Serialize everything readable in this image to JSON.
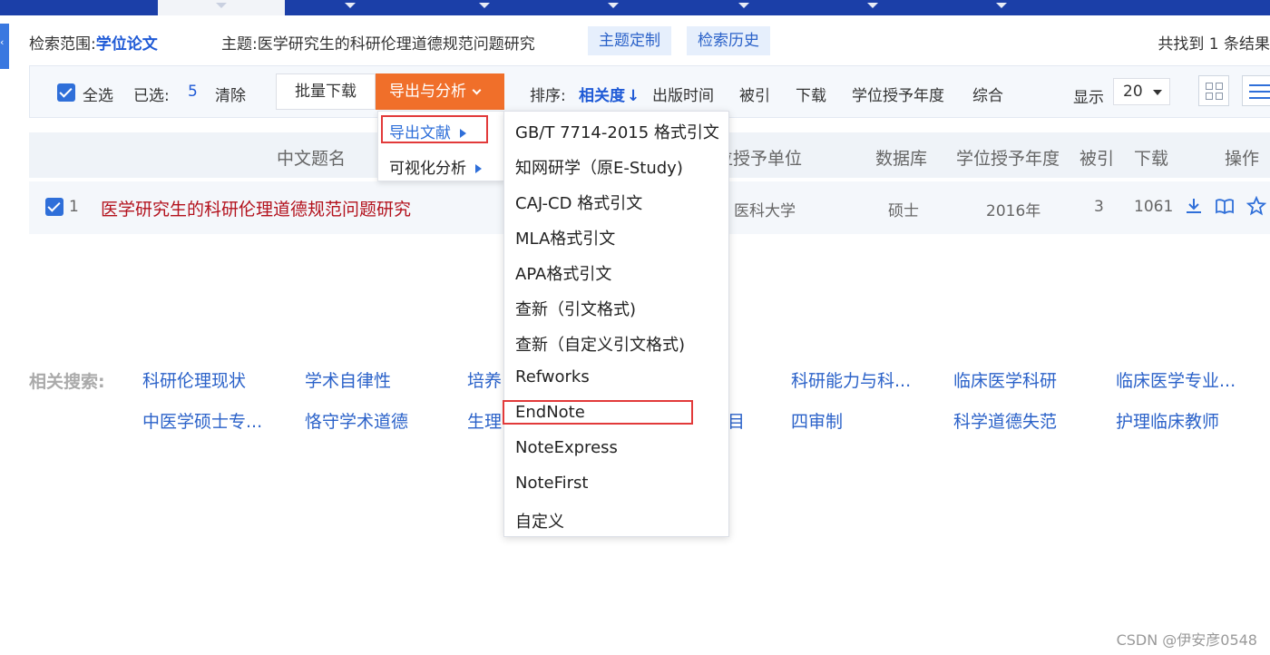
{
  "scope": {
    "label": "检索范围:",
    "value": "学位论文",
    "topic_label": "主题:",
    "topic_value": "医学研究生的科研伦理道德规范问题研究",
    "btn_custom": "主题定制",
    "btn_history": "检索历史",
    "found_text": "共找到 1 条结果"
  },
  "toolbar": {
    "select_all": "全选",
    "selected_label": "已选:",
    "selected_count": "5",
    "clear": "清除",
    "batch_download": "批量下载",
    "export_analyze": "导出与分析",
    "sort_label": "排序:",
    "sort_relevance": "相关度",
    "sort_arrow": "↓",
    "sort_options": [
      "出版时间",
      "被引",
      "下载",
      "学位授予年度",
      "综合"
    ],
    "display_label": "显示",
    "page_size": "20"
  },
  "table": {
    "headers": {
      "title": "中文题名",
      "unit": "学位授予单位",
      "database": "数据库",
      "year": "学位授予年度",
      "cited": "被引",
      "downloads": "下载",
      "actions": "操作"
    },
    "rows": [
      {
        "index": "1",
        "title": "医学研究生的科研伦理道德规范问题研究",
        "unit": "医科大学",
        "database": "硕士",
        "year": "2016年",
        "cited": "3",
        "downloads": "1061"
      }
    ]
  },
  "export_menu": {
    "items": [
      "导出文献",
      "可视化分析"
    ]
  },
  "format_menu": {
    "items": [
      "GB/T 7714-2015 格式引文",
      "知网研学（原E-Study)",
      "CAJ-CD 格式引文",
      "MLA格式引文",
      "APA格式引文",
      "查新（引文格式)",
      "查新（自定义引文格式)",
      "Refworks",
      "EndNote",
      "NoteExpress",
      "NoteFirst",
      "自定义"
    ]
  },
  "related": {
    "label": "相关搜索:",
    "row1": [
      "科研伦理现状",
      "学术自律性",
      "培养",
      "科研能力与科...",
      "临床医学科研",
      "临床医学专业..."
    ],
    "row2": [
      "中医学硕士专...",
      "恪守学术道德",
      "生理",
      "目",
      "四审制",
      "科学道德失范",
      "护理临床教师"
    ]
  },
  "watermark": "CSDN @伊安彦0548",
  "colors": {
    "accent": "#1f5ad6",
    "export_orange": "#f06f2a",
    "title_red": "#b3121d",
    "highlight_box": "#e23a3a",
    "nav_blue": "#1b3fa8"
  }
}
